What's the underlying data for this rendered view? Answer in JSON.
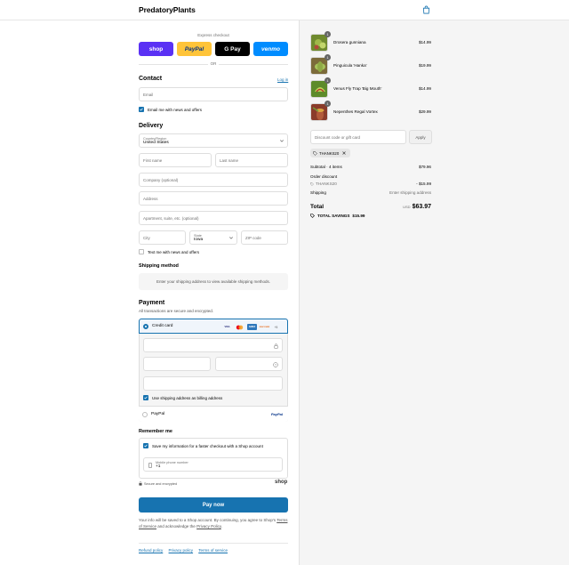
{
  "header": {
    "brand": "PredatoryPlants",
    "cart_icon": "shopping-bag-icon"
  },
  "express": {
    "label": "Express checkout",
    "buttons": [
      {
        "label": "shop",
        "color": "#5a31f4",
        "text_color": "#ffffff"
      },
      {
        "label": "PayPal",
        "color": "#ffc439",
        "text_color": "#003087"
      },
      {
        "label": "G Pay",
        "color": "#000000",
        "text_color": "#ffffff"
      },
      {
        "label": "venmo",
        "color": "#008cff",
        "text_color": "#ffffff"
      }
    ],
    "or": "OR"
  },
  "contact": {
    "title": "Contact",
    "login": "Log in",
    "email_placeholder": "Email",
    "newsletter": "Email me with news and offers"
  },
  "delivery": {
    "title": "Delivery",
    "country_label": "Country/Region",
    "country_value": "United States",
    "first_name": "First name",
    "last_name": "Last name",
    "company": "Company (optional)",
    "address": "Address",
    "apartment": "Apartment, suite, etc. (optional)",
    "city": "City",
    "state_label": "State",
    "state_value": "Iowa",
    "zip": "ZIP code",
    "text_me": "Text me with news and offers"
  },
  "shipping": {
    "title": "Shipping method",
    "info": "Enter your shipping address to view available shipping methods."
  },
  "payment": {
    "title": "Payment",
    "subtitle": "All transactions are secure and encrypted.",
    "credit_card": "Credit card",
    "card_brands": [
      "VISA",
      "MC",
      "AMEX",
      "DISCOVER",
      "+5"
    ],
    "billing_same": "Use shipping address as billing address",
    "paypal": "PayPal",
    "paypal_logo": "PayPal"
  },
  "remember": {
    "title": "Remember me",
    "save_info": "Save my information for a faster checkout with a Shop account",
    "phone_label": "Mobile phone number",
    "phone_value": "+1",
    "secure": "Secure and encrypted",
    "shop": "shop"
  },
  "paynow": "Pay now",
  "legal": {
    "line1": "Your info will be saved to a Shop account. By continuing, you agree to Shop's",
    "tos": "Terms of Service",
    "mid": "and acknowledge the",
    "privacy": "Privacy Policy",
    "end": "."
  },
  "footer": {
    "refund": "Refund policy",
    "privacy": "Privacy policy",
    "terms": "Terms of service"
  },
  "cart": {
    "items": [
      {
        "name": "Drosera gunniana",
        "price": "$14.99",
        "qty": "1",
        "color": "#6f8a2e"
      },
      {
        "name": "Pinguicula 'Hanka'",
        "price": "$19.99",
        "qty": "1",
        "color": "#7c6b3a"
      },
      {
        "name": "Venus Fly Trap 'Big Mouth'",
        "price": "$14.99",
        "qty": "1",
        "color": "#5d8b2a"
      },
      {
        "name": "Nepenthes Regal Vortex",
        "price": "$29.99",
        "qty": "1",
        "color": "#8a3b2a"
      }
    ],
    "discount_placeholder": "Discount code or gift card",
    "apply": "Apply",
    "code": "THANKS20",
    "subtotal_label": "Subtotal · 4 items",
    "subtotal": "$79.96",
    "order_discount": "Order discount",
    "discount_code": "THANKS20",
    "discount_amount": "- $15.99",
    "shipping_label": "Shipping",
    "shipping_value": "Enter shipping address",
    "total_label": "Total",
    "currency": "USD",
    "total": "$63.97",
    "savings_label": "TOTAL SAVINGS",
    "savings": "$15.99"
  }
}
